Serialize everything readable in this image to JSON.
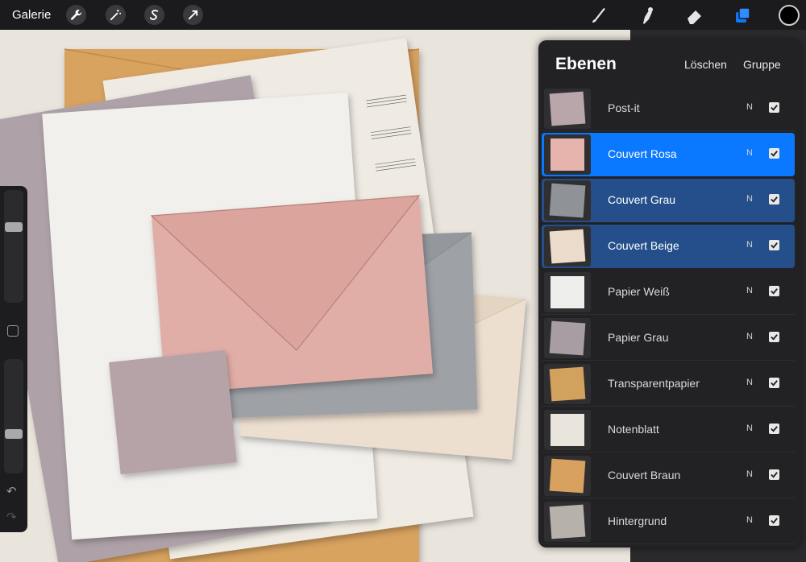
{
  "topbar": {
    "gallery_label": "Galerie",
    "left_tools": [
      "wrench-icon",
      "magic-wand-icon",
      "selection-s-icon",
      "transform-arrow-icon"
    ],
    "right_tools": [
      "brush-icon",
      "smudge-icon",
      "eraser-icon",
      "layers-icon"
    ],
    "current_color": "#000000",
    "layers_active_color": "#0a78ff"
  },
  "layers_panel": {
    "title": "Ebenen",
    "delete_label": "Löschen",
    "group_label": "Gruppe",
    "layers": [
      {
        "name": "Post-it",
        "blend": "N",
        "visible": true,
        "state": "normal",
        "thumb_color": "#b9a6ab"
      },
      {
        "name": "Couvert Rosa",
        "blend": "N",
        "visible": true,
        "state": "primary",
        "thumb_color": "#e6b3ad"
      },
      {
        "name": "Couvert Grau",
        "blend": "N",
        "visible": true,
        "state": "secondary",
        "thumb_color": "#8f9296"
      },
      {
        "name": "Couvert Beige",
        "blend": "N",
        "visible": true,
        "state": "secondary",
        "thumb_color": "#eadbcb"
      },
      {
        "name": "Papier Weiß",
        "blend": "N",
        "visible": true,
        "state": "normal",
        "thumb_color": "#eeeeec"
      },
      {
        "name": "Papier Grau",
        "blend": "N",
        "visible": true,
        "state": "normal",
        "thumb_color": "#a99da4"
      },
      {
        "name": "Transparentpapier",
        "blend": "N",
        "visible": true,
        "state": "normal",
        "thumb_color": "#d2a15d"
      },
      {
        "name": "Notenblatt",
        "blend": "N",
        "visible": true,
        "state": "normal",
        "thumb_color": "#e9e5dc"
      },
      {
        "name": "Couvert Braun",
        "blend": "N",
        "visible": true,
        "state": "normal",
        "thumb_color": "#d8a15f"
      },
      {
        "name": "Hintergrund",
        "blend": "N",
        "visible": true,
        "state": "normal",
        "thumb_color": "#b6b1aa"
      }
    ]
  },
  "sidebar": {
    "brush_size_level": 0.77,
    "opacity_level": 0.35,
    "undo_icon": "undo-icon",
    "redo_icon": "redo-icon"
  }
}
